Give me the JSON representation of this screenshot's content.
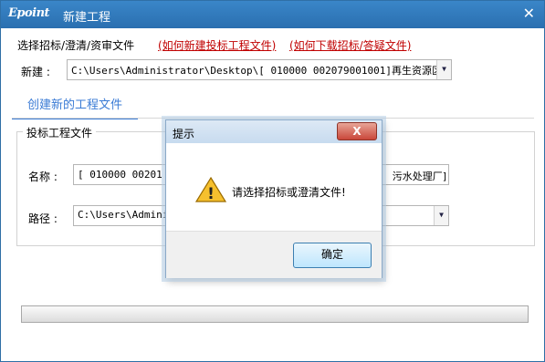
{
  "window": {
    "logo": "Epoint",
    "title": "新建工程",
    "close_glyph": "✕"
  },
  "top": {
    "select_label": "选择招标/澄清/资审文件",
    "link_new": "(如何新建投标工程文件)",
    "link_download": "(如何下载招标/答疑文件)"
  },
  "new_field": {
    "label": "新建 :",
    "value": "C:\\Users\\Administrator\\Desktop\\[    010000   002079001001]再生资源区",
    "arrow": "▼"
  },
  "tab": {
    "label": "创建新的工程文件"
  },
  "group": {
    "title": "投标工程文件",
    "name_label": "名称 :",
    "name_value": "[   010000   00201",
    "name_value_tail": "污水处理厂]",
    "path_label": "路径 :",
    "path_value": "C:\\Users\\Adminis",
    "arrow": "▼"
  },
  "dialog": {
    "title": "提示",
    "close_glyph": "X",
    "message": "请选择招标或澄清文件!",
    "ok_label": "确定",
    "warning_mark": "!"
  },
  "colors": {
    "titlebar": "#2a6fb0",
    "link": "#c00000",
    "tab_accent": "#3a7bd5",
    "dialog_close": "#c9473a"
  }
}
